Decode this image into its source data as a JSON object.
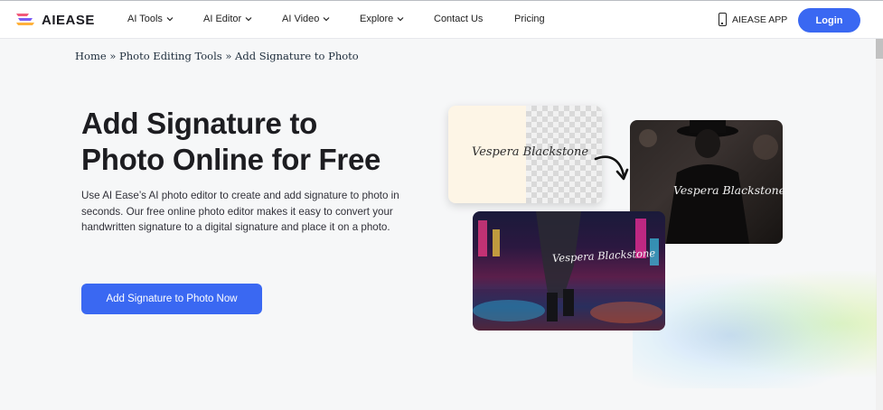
{
  "brand": {
    "name": "AIEASE",
    "accent": "#3a68f2"
  },
  "nav": [
    {
      "label": "AI Tools",
      "has_dropdown": true
    },
    {
      "label": "AI Editor",
      "has_dropdown": true
    },
    {
      "label": "AI Video",
      "has_dropdown": true
    },
    {
      "label": "Explore",
      "has_dropdown": true
    },
    {
      "label": "Contact Us",
      "has_dropdown": false
    },
    {
      "label": "Pricing",
      "has_dropdown": false
    }
  ],
  "header": {
    "app_label": "AIEASE APP",
    "login_label": "Login"
  },
  "breadcrumb": {
    "home": "Home",
    "sep": " » ",
    "section": "Photo Editing Tools",
    "current": "Add Signature to Photo"
  },
  "hero": {
    "title_line1": "Add Signature to",
    "title_line2": "Photo Online for Free",
    "description": "Use AI Ease’s AI photo editor to create and add signature to photo in seconds. Our free online photo editor makes it easy to convert your handwritten signature to a digital signature and place it on a photo.",
    "cta_label": "Add Signature to Photo Now"
  },
  "preview": {
    "signature_text": "Vespera Blackstone"
  }
}
